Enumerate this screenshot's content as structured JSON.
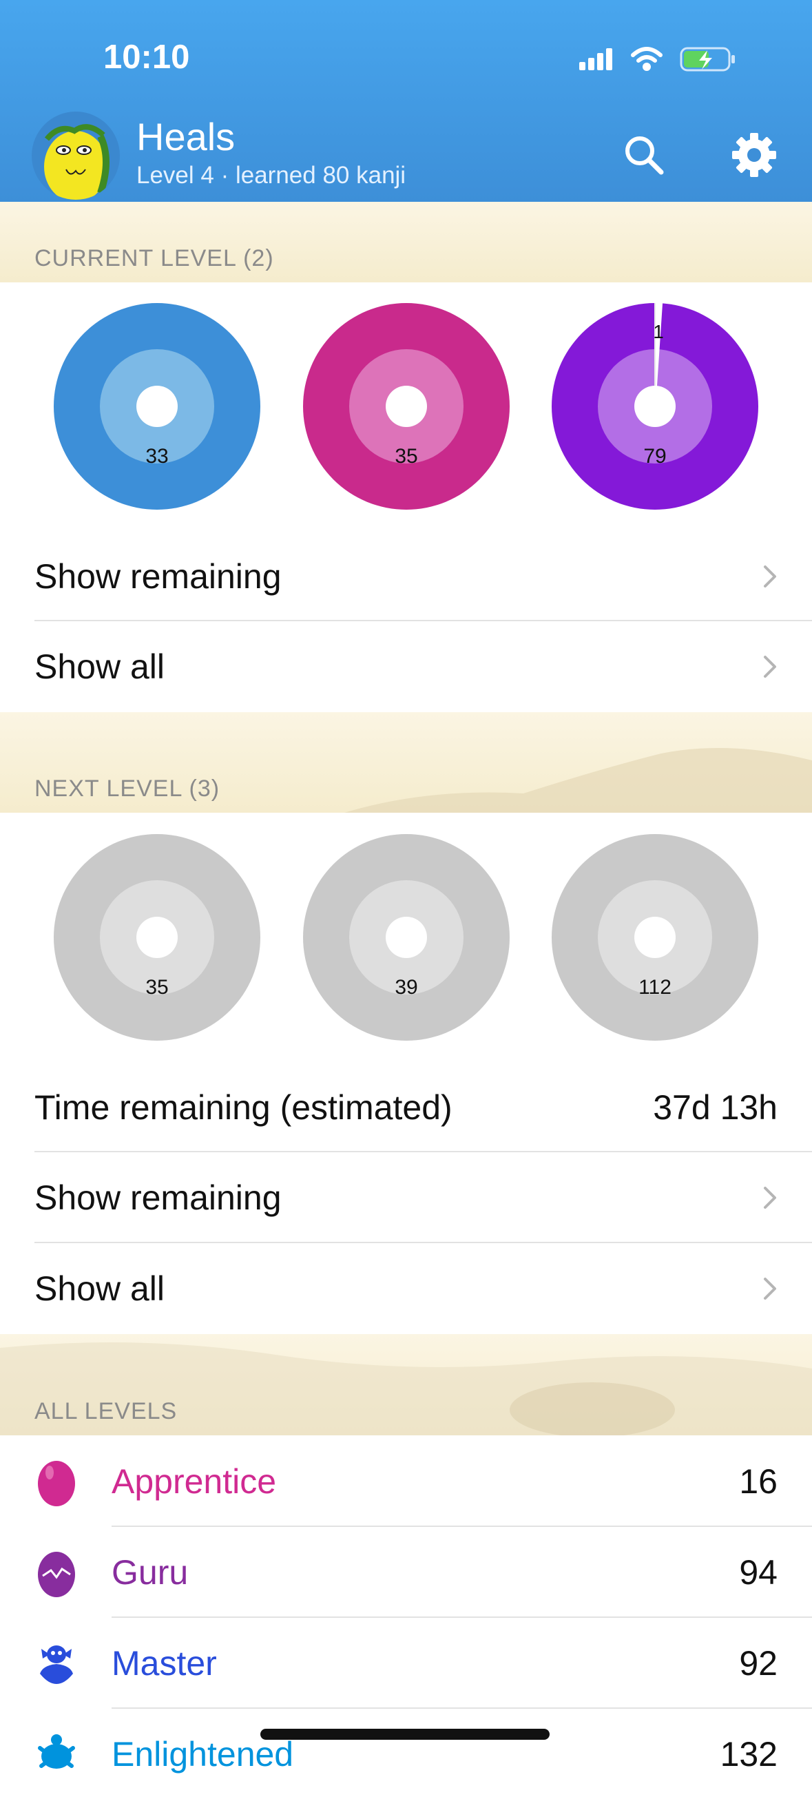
{
  "status": {
    "time": "10:10"
  },
  "header": {
    "title": "Heals",
    "subtitle": "Level 4 · learned 80 kanji"
  },
  "current_level": {
    "heading": "CURRENT LEVEL (2)",
    "donuts": [
      {
        "label": "33",
        "outer": "#3d8fd8",
        "inner": "#7cb9e6"
      },
      {
        "label": "35",
        "outer": "#c92a8c",
        "inner": "#dd73b9"
      },
      {
        "label": "79",
        "outer": "#8419d8",
        "inner": "#b36ee6",
        "slice_label": "1"
      }
    ],
    "show_remaining": "Show remaining",
    "show_all": "Show all"
  },
  "next_level": {
    "heading": "NEXT LEVEL (3)",
    "donuts": [
      {
        "label": "35",
        "outer": "#c9c9c9",
        "inner": "#dedede"
      },
      {
        "label": "39",
        "outer": "#c9c9c9",
        "inner": "#dedede"
      },
      {
        "label": "112",
        "outer": "#c9c9c9",
        "inner": "#dedede"
      }
    ],
    "time_remaining_label": "Time remaining (estimated)",
    "time_remaining_value": "37d 13h",
    "show_remaining": "Show remaining",
    "show_all": "Show all"
  },
  "all_levels": {
    "heading": "ALL LEVELS",
    "items": [
      {
        "name": "Apprentice",
        "count": "16",
        "color": "#d02a91",
        "icon": "egg-icon"
      },
      {
        "name": "Guru",
        "count": "94",
        "color": "#882d9e",
        "icon": "hatching-egg-icon"
      },
      {
        "name": "Master",
        "count": "92",
        "color": "#294ddb",
        "icon": "hatchling-icon"
      },
      {
        "name": "Enlightened",
        "count": "132",
        "color": "#0093dd",
        "icon": "turtle-icon"
      }
    ]
  }
}
